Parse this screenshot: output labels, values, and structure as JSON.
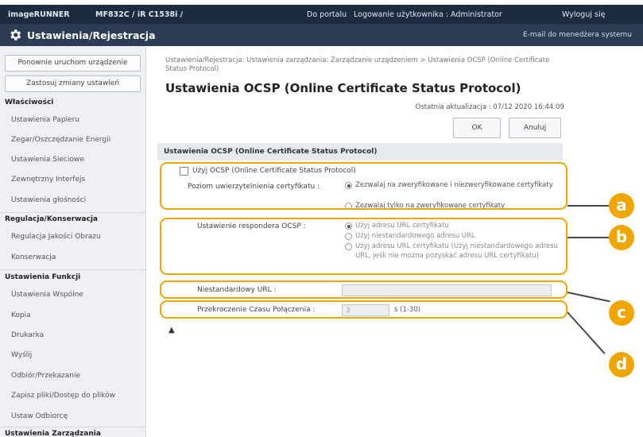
{
  "header": {
    "brand": "imageRUNNER",
    "model": "MF832C / iR C1538i /",
    "portal": "Do portalu",
    "login_user": "Logowanie użytkownika :  Administrator",
    "logout": "Wyloguj się"
  },
  "titlebar": {
    "title": "Ustawienia/Rejestracja",
    "email_admin": "E-mail do menedżera systemu"
  },
  "sidebar": {
    "restart_button": "Ponownie uruchom urządzenie",
    "apply_button": "Zastosuj zmiany ustawień",
    "groups": [
      {
        "title": "Właściwości",
        "items": [
          "Ustawienia Papieru",
          "Zegar/Oszczędzanie Energii",
          "Ustawienia Sieciowe",
          "Zewnętrzny Interfejs",
          "Ustawienia głośności"
        ]
      },
      {
        "title": "Regulacja/Konserwacja",
        "items": [
          "Regulacja Jakości Obrazu",
          "Konserwacja"
        ]
      },
      {
        "title": "Ustawienia Funkcji",
        "items": [
          "Ustawienia Wspólne",
          "Kopia",
          "Drukarka",
          "Wyślij",
          "Odbiór/Przekazanie",
          "Zapisz pliki/Dostęp do plików",
          "Ustaw Odbiorcę"
        ]
      },
      {
        "title": "Ustawienia Zarządzania",
        "items": []
      }
    ]
  },
  "main": {
    "breadcrumb": "Ustawienia/Rejestracja: Ustawienia zarządzania: Zarządzanie urządzeniem > Ustawienia OCSP (Online Certificate Status Protocol)",
    "page_title": "Ustawienia OCSP (Online Certificate Status Protocol)",
    "last_updated": "Ostatnia aktualizacja : 07/12 2020 16:44:09",
    "ok_button": "OK",
    "cancel_button": "Anuluj",
    "section_title": "Ustawienia OCSP (Online Certificate Status Protocol)",
    "use_ocsp": {
      "label": "Użyj OCSP (Online Certificate Status Protocol)",
      "checked": false
    },
    "verification_level": {
      "label": "Poziom uwierzytelnienia certyfikatu :",
      "options": [
        "Zezwalaj na zweryfikowane i niezweryfikowane certyfikaty",
        "Zezwalaj tylko na zweryfikowane certyfikaty"
      ],
      "selected": 0
    },
    "responder": {
      "label": "Ustawienie respondera OCSP :",
      "options": [
        "Użyj adresu URL certyfikatu",
        "Użyj niestandardowego adresu URL",
        "Użyj adresu URL certyfikatu (Użyj niestandardowego adresu URL, jeśli nie można pozyskać adresu URL certyfikatu)"
      ],
      "selected": 0
    },
    "custom_url": {
      "label": "Niestandardowy URL :",
      "value": ""
    },
    "timeout": {
      "label": "Przekroczenie Czasu Połączenia :",
      "value": "3",
      "range": "s (1-30)"
    },
    "top_link": "▲"
  },
  "callouts": [
    "a",
    "b",
    "c",
    "d"
  ],
  "colors": {
    "accent": "#f0a600",
    "header_bg": "#1d2b40",
    "titlebar_bg": "#2c3c54"
  }
}
